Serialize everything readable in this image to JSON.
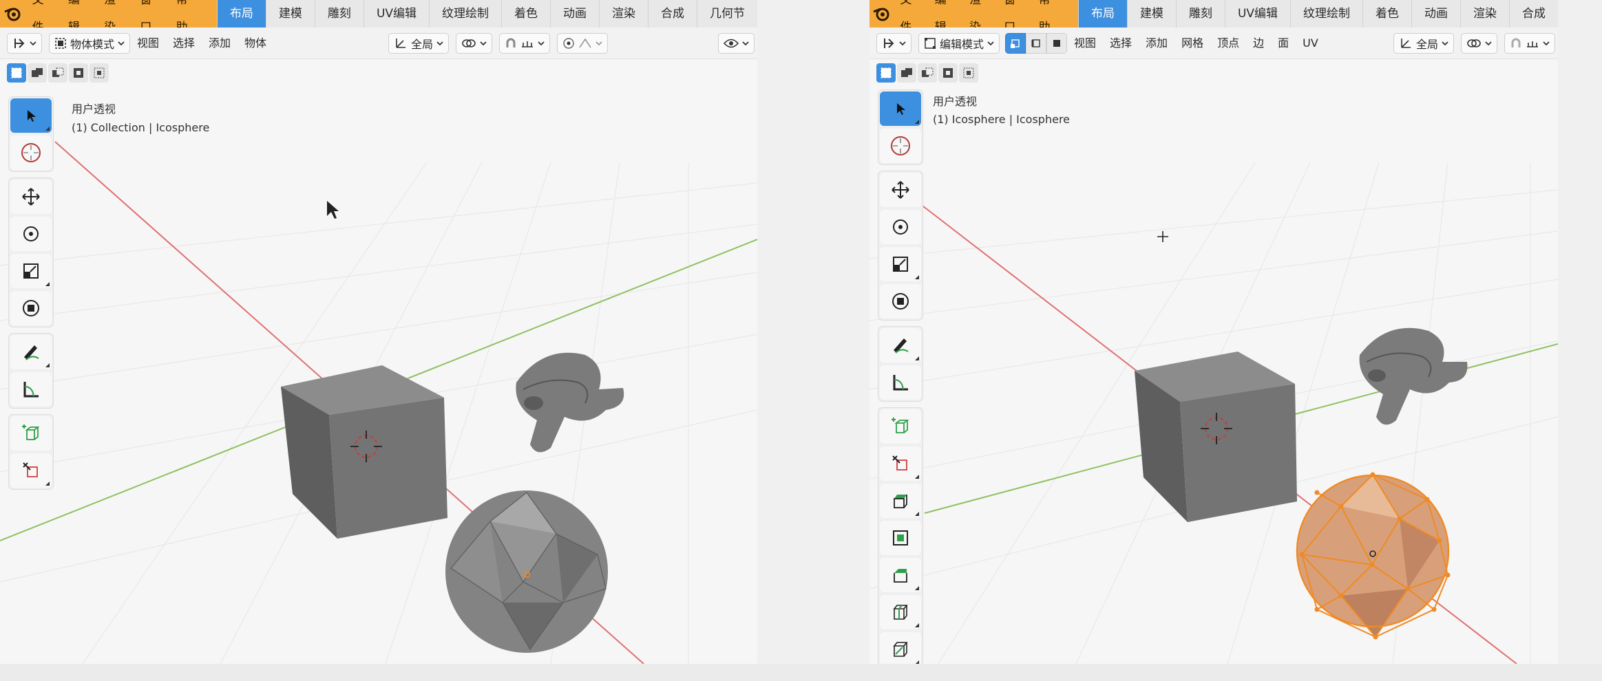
{
  "left": {
    "menu": [
      "文件",
      "编辑",
      "渲染",
      "窗口",
      "帮助"
    ],
    "workspaces": [
      "布局",
      "建模",
      "雕刻",
      "UV编辑",
      "纹理绘制",
      "着色",
      "动画",
      "渲染",
      "合成",
      "几何节"
    ],
    "active_workspace": "布局",
    "header": {
      "mode": "物体模式",
      "menus": [
        "视图",
        "选择",
        "添加",
        "物体"
      ],
      "transform_orientation": "全局"
    },
    "viewport": {
      "view_name": "用户透视",
      "context": "(1) Collection | Icosphere"
    }
  },
  "right": {
    "menu": [
      "文件",
      "编辑",
      "渲染",
      "窗口",
      "帮助"
    ],
    "workspaces": [
      "布局",
      "建模",
      "雕刻",
      "UV编辑",
      "纹理绘制",
      "着色",
      "动画",
      "渲染",
      "合成"
    ],
    "active_workspace": "布局",
    "header": {
      "mode": "编辑模式",
      "menus": [
        "视图",
        "选择",
        "添加",
        "网格",
        "顶点",
        "边",
        "面",
        "UV"
      ],
      "transform_orientation": "全局"
    },
    "viewport": {
      "view_name": "用户透视",
      "context": "(1) Icosphere | Icosphere"
    }
  },
  "colors": {
    "topbar": "#f5a93a",
    "active_tab": "#3d8fe0",
    "x_axis": "#e07070",
    "y_axis": "#8fc060",
    "selection": "#f08a24",
    "object": "#767676"
  }
}
